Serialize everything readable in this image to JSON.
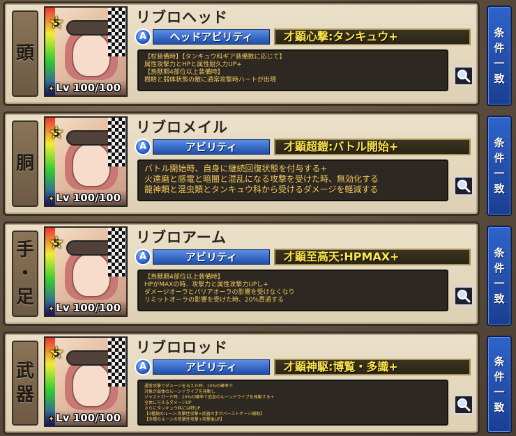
{
  "equipment": [
    {
      "slot_chars": [
        "頭"
      ],
      "rarity": "5",
      "level_prefix": "Lv",
      "level": "100/100",
      "name": "リブロヘッド",
      "ability_badge": "A",
      "ability_type": "ヘッドアビリティ",
      "skill": "才顕心撃:タンキュウ+",
      "desc_lines": [
        "【杖装備時】【タンキュウ科ギア装備数に応じて】",
        "属性攻撃力とHPと属性耐久力UP+",
        "【鳥獣期4部位以上装備時】",
        "樹精と弱体状態の敵に通常攻撃時ハートが出現"
      ]
    },
    {
      "slot_chars": [
        "胴"
      ],
      "rarity": "5",
      "level_prefix": "Lv",
      "level": "100/100",
      "name": "リブロメイル",
      "ability_badge": "A",
      "ability_type": "アビリティ",
      "skill": "才顕超鎧:バトル開始+",
      "desc_lines": [
        "バトル開始時、自身に継続回復状態を付与する+",
        "火達磨と感電と暗闇と混乱になる攻撃を受けた時、無効化する",
        "龍神類と混虫類とタンキュウ科から受けるダメージを軽減する"
      ]
    },
    {
      "slot_chars": [
        "手",
        "・",
        "足"
      ],
      "rarity": "5",
      "level_prefix": "Lv",
      "level": "100/100",
      "name": "リブロアーム",
      "ability_badge": "A",
      "ability_type": "アビリティ",
      "skill": "才顕至高天:HPMAX+",
      "desc_lines": [
        "【鳥獣期4部位以上装備時】",
        "HPがMAXの時、攻撃力と属性攻撃力UPし+",
        "ダメージオーラとバリアオーラの影響を受けなくなり",
        "リミットオーラの影響を受けた時、20%貫通する"
      ]
    },
    {
      "slot_chars": [
        "武",
        "器"
      ],
      "rarity": "5",
      "level_prefix": "Lv",
      "level": "100/100",
      "name": "リブロロッド",
      "ability_badge": "A",
      "ability_type": "アビリティ",
      "skill": "才顕神駆:博覧・多識+",
      "desc_lines": [
        "通常攻撃でダメージを与えた時、10%の確率で",
        "対象が弱体のルーンドライブを発動し",
        "ジャストガード時、20%の確率で追加のルーンドライブを発動する+",
        "全体に与えるダメージUP",
        "さらにタンキュウ科には特UP",
        "【3種類のルーン:攻撃性攻撃+武器の手がバーストゲージ補助】",
        "【多種のルーンの攻撃性攻撃+攻撃後UP】"
      ]
    }
  ],
  "side_button": {
    "chars": [
      "条",
      "件",
      "一",
      "致"
    ]
  },
  "icons": {
    "search": "magnifier-icon",
    "ability_badge": "ability-a-badge-icon",
    "rarity": "rarity-star-icon"
  },
  "colors": {
    "accent_blue": "#1e4ea8",
    "skill_text": "#ffe64a",
    "desc_text": "#f0c95a"
  }
}
